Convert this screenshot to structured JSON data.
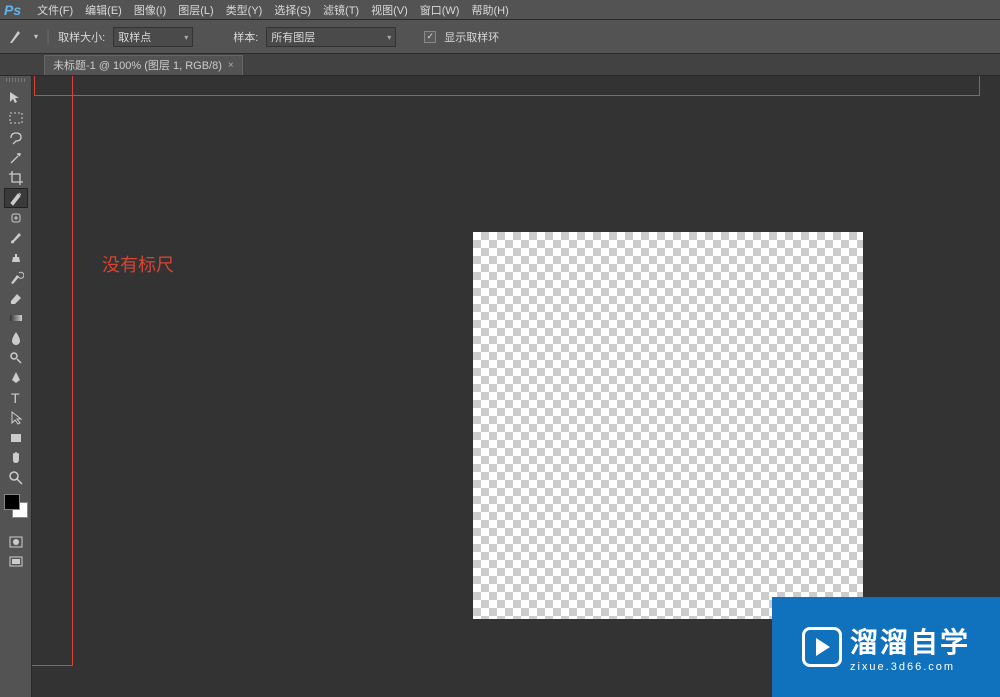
{
  "app": {
    "logo": "Ps"
  },
  "menu": {
    "items": [
      {
        "label": "文件(F)"
      },
      {
        "label": "编辑(E)"
      },
      {
        "label": "图像(I)"
      },
      {
        "label": "图层(L)"
      },
      {
        "label": "类型(Y)"
      },
      {
        "label": "选择(S)"
      },
      {
        "label": "滤镜(T)"
      },
      {
        "label": "视图(V)"
      },
      {
        "label": "窗口(W)"
      },
      {
        "label": "帮助(H)"
      }
    ]
  },
  "options": {
    "sample_size_label": "取样大小:",
    "sample_size_value": "取样点",
    "sample_label": "样本:",
    "sample_value": "所有图层",
    "show_sample_ring_label": "显示取样环"
  },
  "tabs": [
    {
      "title": "未标题-1 @ 100% (图层 1, RGB/8)"
    }
  ],
  "tools": [
    {
      "name": "move-tool"
    },
    {
      "name": "marquee-tool"
    },
    {
      "name": "lasso-tool"
    },
    {
      "name": "magic-wand-tool"
    },
    {
      "name": "crop-tool"
    },
    {
      "name": "eyedropper-tool",
      "active": true
    },
    {
      "name": "healing-brush-tool"
    },
    {
      "name": "brush-tool"
    },
    {
      "name": "clone-stamp-tool"
    },
    {
      "name": "history-brush-tool"
    },
    {
      "name": "eraser-tool"
    },
    {
      "name": "gradient-tool"
    },
    {
      "name": "blur-tool"
    },
    {
      "name": "dodge-tool"
    },
    {
      "name": "pen-tool"
    },
    {
      "name": "type-tool"
    },
    {
      "name": "path-selection-tool"
    },
    {
      "name": "rectangle-tool"
    },
    {
      "name": "hand-tool"
    },
    {
      "name": "zoom-tool"
    }
  ],
  "annotation": {
    "text": "没有标尺"
  },
  "colors": {
    "foreground": "#000000",
    "background": "#ffffff"
  },
  "watermark": {
    "title": "溜溜自学",
    "subtitle": "zixue.3d66.com"
  }
}
